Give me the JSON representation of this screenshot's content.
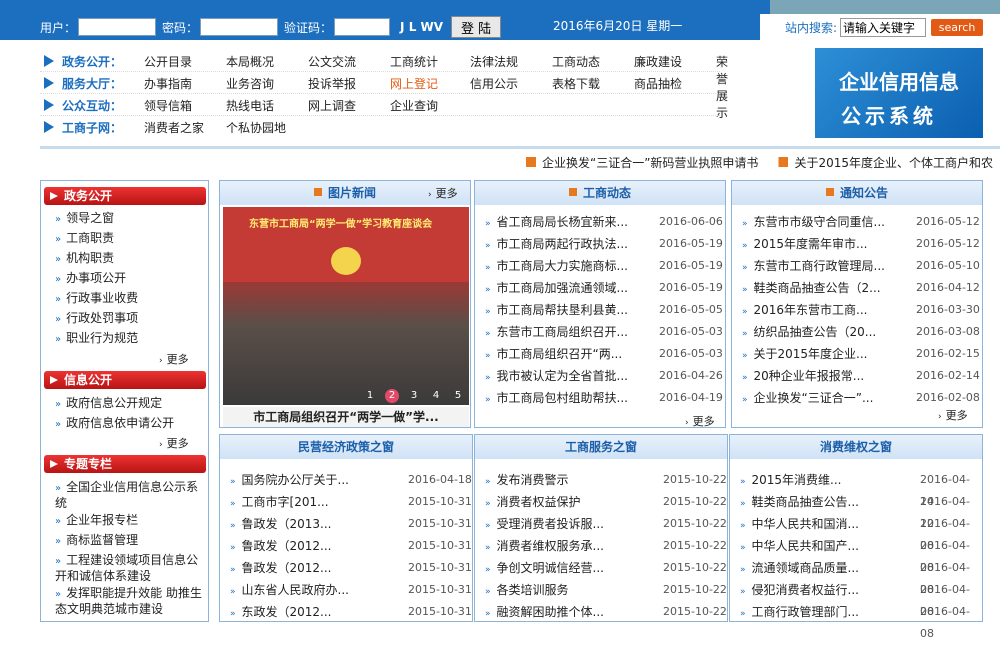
{
  "header": {
    "user_label": "用户：",
    "pass_label": "密码：",
    "captcha_label": "验证码：",
    "captcha_text": "J L WV",
    "login_label": "登 陆",
    "date": "2016年6月20日 星期一",
    "search_label": "站内搜索:",
    "search_placeholder": "请输入关键字",
    "search_button": "search"
  },
  "nav": [
    {
      "cat": "政务公开：",
      "items": [
        "公开目录",
        "本局概况",
        "公文交流",
        "工商统计",
        "法律法规",
        "工商动态",
        "廉政建设",
        "荣誉展示"
      ]
    },
    {
      "cat": "服务大厅：",
      "items": [
        "办事指南",
        "业务咨询",
        "投诉举报",
        "网上登记",
        "信用公示",
        "表格下载",
        "商品抽检"
      ]
    },
    {
      "cat": "公众互动：",
      "items": [
        "领导信箱",
        "热线电话",
        "网上调查",
        "企业查询"
      ]
    },
    {
      "cat": "工商子网：",
      "items": [
        "消费者之家",
        "个私协园地"
      ]
    }
  ],
  "banner": {
    "line1": "企业信用信息",
    "line2": "公示系统"
  },
  "marquee": [
    "企业换发“三证合一”新码营业执照申请书",
    "关于2015年度企业、个体工商户和农"
  ],
  "sidebar": {
    "sec1": "政务公开",
    "sec1_items": [
      "领导之窗",
      "工商职责",
      "机构职责",
      "办事项公开",
      "行政事业收费",
      "行政处罚事项",
      "职业行为规范"
    ],
    "sec2": "信息公开",
    "sec2_items": [
      "政府信息公开规定",
      "政府信息依申请公开"
    ],
    "sec3": "专题专栏",
    "sec3_items": [
      "全国企业信用信息公示系统",
      "企业年报专栏",
      "商标监督管理",
      "工程建设领域项目信息公开和诚信体系建设",
      "发挥职能提升效能 助推生态文明典范城市建设"
    ],
    "more": "更多"
  },
  "photo": {
    "title": "图片新闻",
    "more": "更多",
    "banner_text": "东营市工商局“两学一做”学习教育座谈会",
    "caption": "市工商局组织召开“两学一做”学...",
    "dots": [
      "1",
      "2",
      "3",
      "4",
      "5"
    ]
  },
  "news": {
    "title": "工商动态",
    "more": "更多",
    "rows": [
      {
        "t": "省工商局局长杨宜新来...",
        "d": "2016-06-06"
      },
      {
        "t": "市工商局两起行政执法...",
        "d": "2016-05-19"
      },
      {
        "t": "市工商局大力实施商标...",
        "d": "2016-05-19"
      },
      {
        "t": "市工商局加强流通领域...",
        "d": "2016-05-19"
      },
      {
        "t": "市工商局帮扶垦利县黄...",
        "d": "2016-05-05"
      },
      {
        "t": "东营市工商局组织召开...",
        "d": "2016-05-03"
      },
      {
        "t": "市工商局组织召开“两...",
        "d": "2016-05-03"
      },
      {
        "t": "我市被认定为全省首批...",
        "d": "2016-04-26"
      },
      {
        "t": "市工商局包村组助帮扶...",
        "d": "2016-04-19"
      }
    ]
  },
  "notice": {
    "title": "通知公告",
    "more": "更多",
    "rows": [
      {
        "t": "东营市市级守合同重信...",
        "d": "2016-05-12"
      },
      {
        "t": "2015年度需年审市...",
        "d": "2016-05-12"
      },
      {
        "t": "东营市工商行政管理局...",
        "d": "2016-05-10"
      },
      {
        "t": "鞋类商品抽查公告（2...",
        "d": "2016-04-12"
      },
      {
        "t": "2016年东营市工商...",
        "d": "2016-03-30"
      },
      {
        "t": "纺织品抽查公告（20...",
        "d": "2016-03-08"
      },
      {
        "t": "关于2015年度企业...",
        "d": "2016-02-15"
      },
      {
        "t": "20种企业年报报常...",
        "d": "2016-02-14"
      },
      {
        "t": "企业换发“三证合一”...",
        "d": "2016-02-08"
      }
    ]
  },
  "policy": {
    "title": "民营经济政策之窗",
    "rows": [
      {
        "t": "国务院办公厅关于...",
        "d": "2016-04-18"
      },
      {
        "t": "工商市字[201...",
        "d": "2015-10-31"
      },
      {
        "t": "鲁政发（2013...",
        "d": "2015-10-31"
      },
      {
        "t": "鲁政发（2012...",
        "d": "2015-10-31"
      },
      {
        "t": "鲁政发（2012...",
        "d": "2015-10-31"
      },
      {
        "t": "山东省人民政府办...",
        "d": "2015-10-31"
      },
      {
        "t": "东政发（2012...",
        "d": "2015-10-31"
      }
    ]
  },
  "service": {
    "title": "工商服务之窗",
    "rows": [
      {
        "t": "发布消费警示",
        "d": "2015-10-22"
      },
      {
        "t": "消费者权益保护",
        "d": "2015-10-22"
      },
      {
        "t": "受理消费者投诉服...",
        "d": "2015-10-22"
      },
      {
        "t": "消费者维权服务承...",
        "d": "2015-10-22"
      },
      {
        "t": "争创文明诚信经营...",
        "d": "2015-10-22"
      },
      {
        "t": "各类培训服务",
        "d": "2015-10-22"
      },
      {
        "t": "融资解困助推个体...",
        "d": "2015-10-22"
      }
    ]
  },
  "consumer": {
    "title": "消费维权之窗",
    "rows": [
      {
        "t": "2015年消费维...",
        "d": "2016-04-14"
      },
      {
        "t": "鞋类商品抽查公告...",
        "d": "2016-04-12"
      },
      {
        "t": "中华人民共和国消...",
        "d": "2016-04-08"
      },
      {
        "t": "中华人民共和国产...",
        "d": "2016-04-08"
      },
      {
        "t": "流通领域商品质量...",
        "d": "2016-04-08"
      },
      {
        "t": "侵犯消费者权益行...",
        "d": "2016-04-08"
      },
      {
        "t": "工商行政管理部门...",
        "d": "2016-04-08"
      }
    ]
  }
}
